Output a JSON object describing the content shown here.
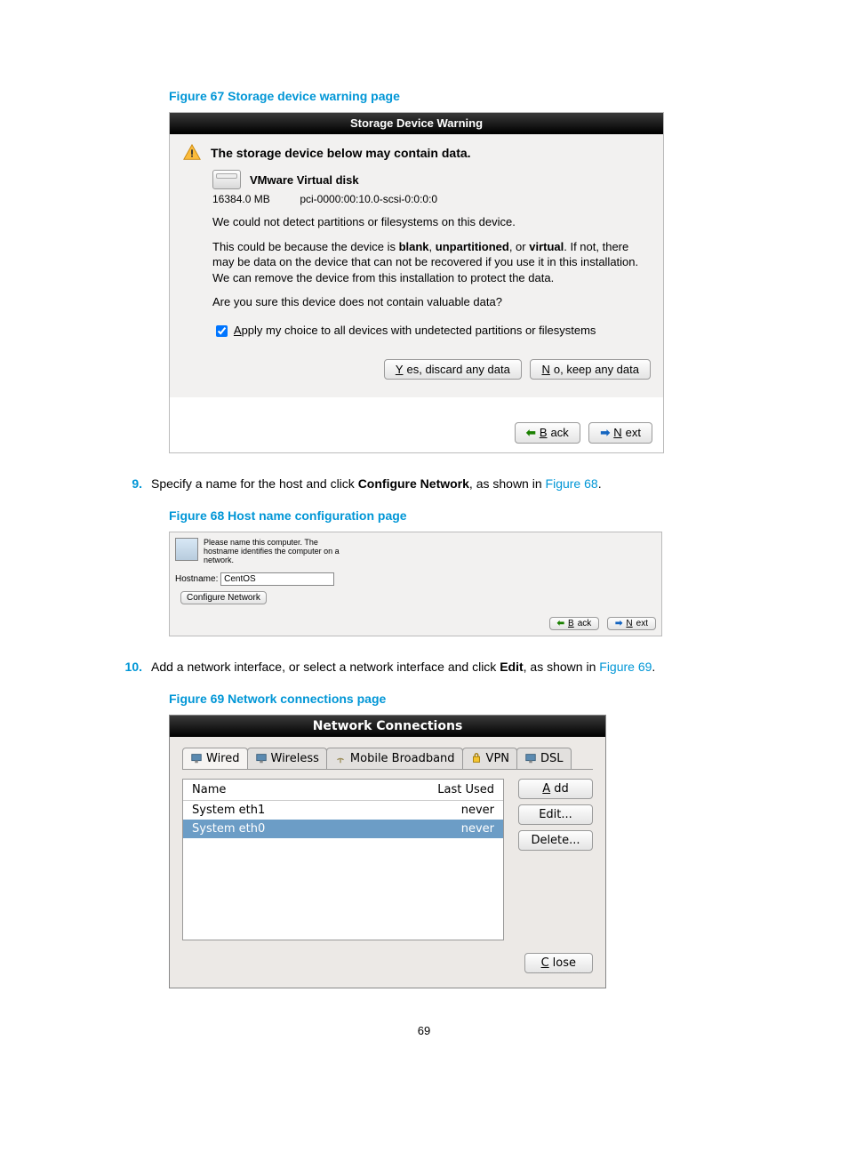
{
  "page_number": "69",
  "fig67": {
    "caption": "Figure 67 Storage device warning page",
    "titlebar": "Storage Device Warning",
    "heading": "The storage device below may contain data.",
    "disk_name": "VMware Virtual disk",
    "disk_size": "16384.0 MB",
    "disk_path": "pci-0000:00:10.0-scsi-0:0:0:0",
    "para1": "We could not detect partitions or filesystems on this device.",
    "para2_a": "This could be because the device is ",
    "para2_b1": "blank",
    "para2_c": ", ",
    "para2_b2": "unpartitioned",
    "para2_d": ", or ",
    "para2_b3": "virtual",
    "para2_e": ". If not, there may be data on the device that can not be recovered if you use it in this installation. We can remove the device from this installation to protect the data.",
    "para3": "Are you sure this device does not contain valuable data?",
    "checkbox_a": "A",
    "checkbox_rest": "pply my choice to all devices with undetected partitions or filesystems",
    "btn_yes_a": "Y",
    "btn_yes_rest": "es, discard any data",
    "btn_no_a": "N",
    "btn_no_rest": "o, keep any data",
    "back_a": "B",
    "back_rest": "ack",
    "next_a": "N",
    "next_rest": "ext"
  },
  "step9": {
    "num": "9.",
    "text_a": "Specify a name for the host and click ",
    "bold": "Configure Network",
    "text_b": ", as shown in ",
    "link": "Figure 68",
    "tail": "."
  },
  "fig68": {
    "caption": "Figure 68 Host name configuration page",
    "note": "Please name this computer.  The hostname identifies the computer on a network.",
    "hostname_label": "Hostname:",
    "hostname_value": "CentOS",
    "confnet": "Configure Network",
    "back_a": "B",
    "back_rest": "ack",
    "next_a": "N",
    "next_rest": "ext"
  },
  "step10": {
    "num": "10.",
    "text_a": "Add a network interface, or select a network interface and click ",
    "bold": "Edit",
    "text_b": ", as shown in ",
    "link": "Figure 69",
    "tail": "."
  },
  "fig69": {
    "caption": "Figure 69 Network connections page",
    "titlebar": "Network Connections",
    "tabs": {
      "wired": "Wired",
      "wireless": "Wireless",
      "mobile": "Mobile Broadband",
      "vpn": "VPN",
      "dsl": "DSL"
    },
    "col_name": "Name",
    "col_last": "Last Used",
    "rows": [
      {
        "name": "System eth1",
        "last": "never",
        "selected": false
      },
      {
        "name": "System eth0",
        "last": "never",
        "selected": true
      }
    ],
    "btn_add_a": "A",
    "btn_add_rest": "dd",
    "btn_edit": "Edit...",
    "btn_delete": "Delete...",
    "btn_close_a": "C",
    "btn_close_rest": "lose"
  }
}
